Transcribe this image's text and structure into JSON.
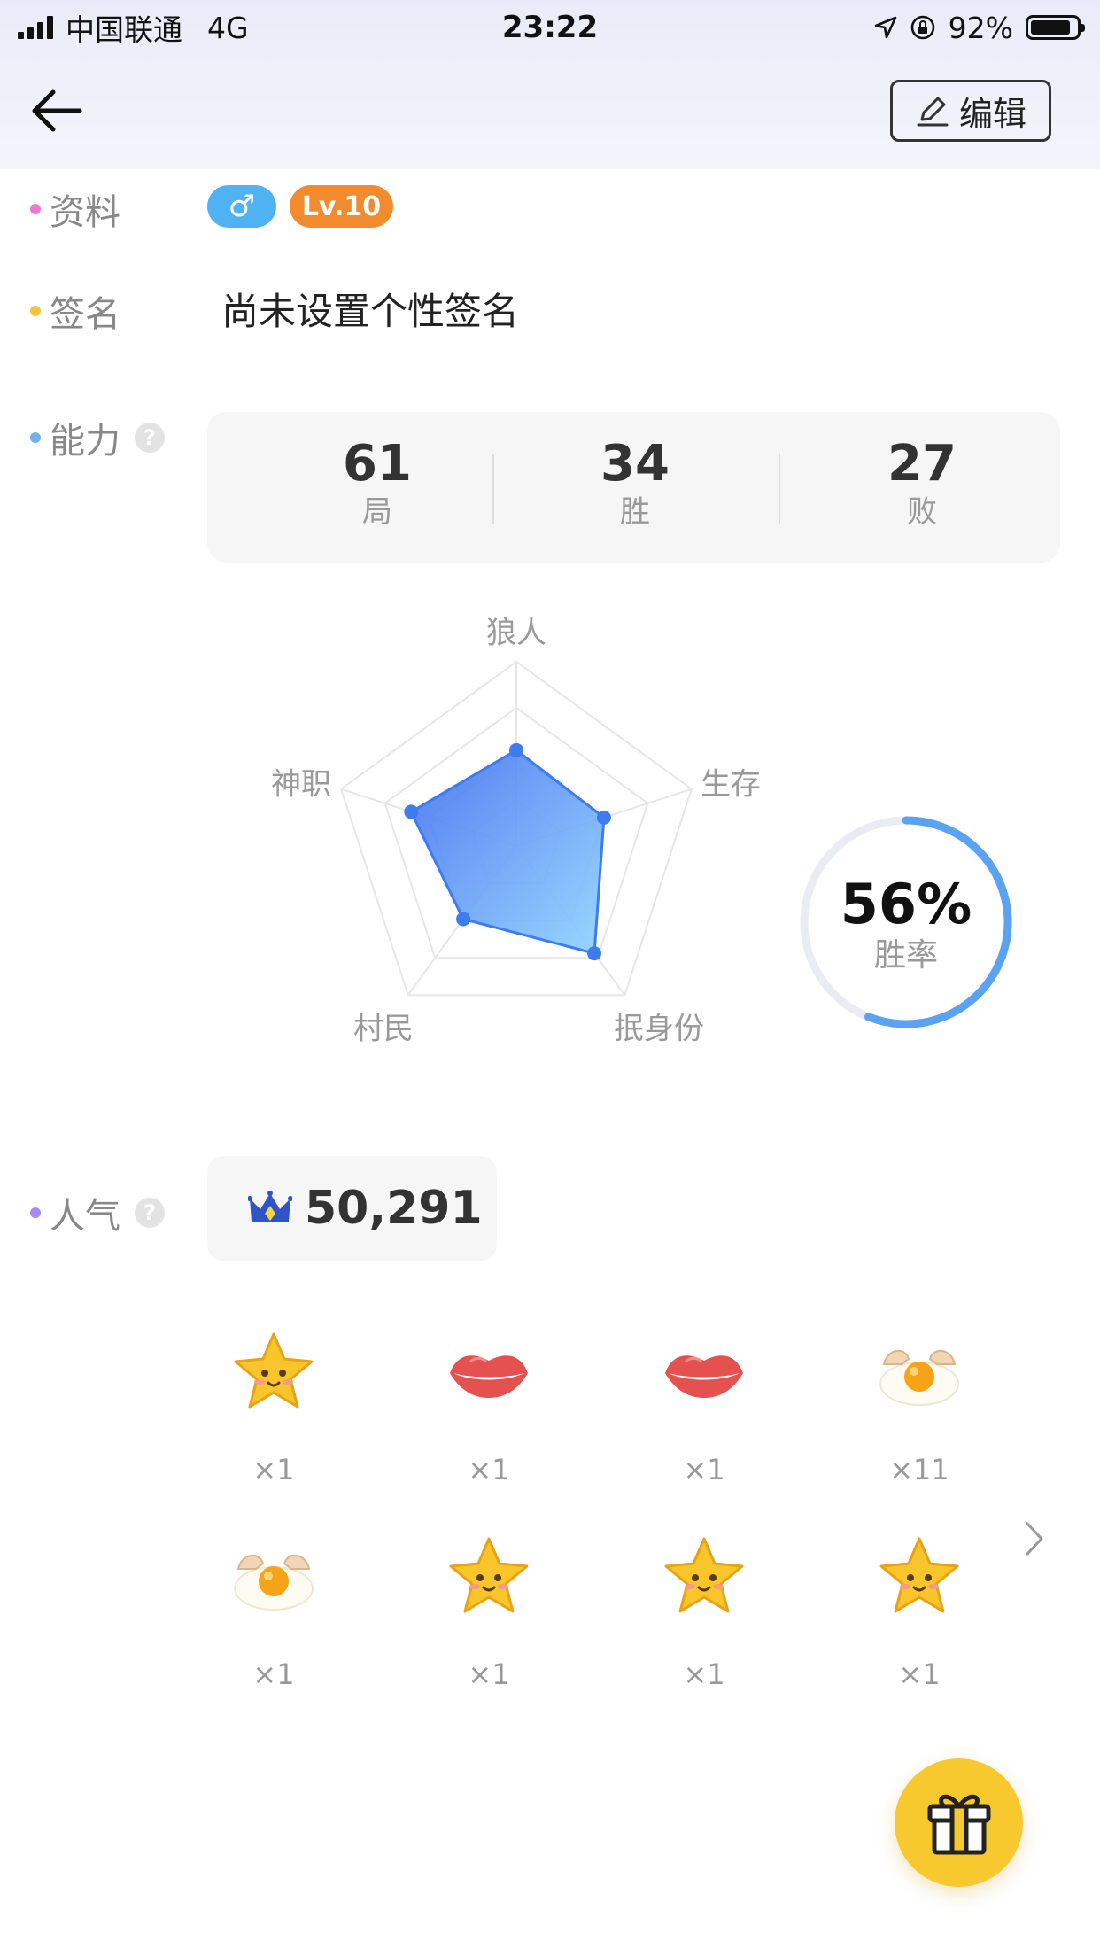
{
  "status_bar": {
    "carrier": "中国联通",
    "network": "4G",
    "time": "23:22",
    "battery_pct": "92%"
  },
  "nav": {
    "edit_label": "编辑"
  },
  "profile": {
    "info_label": "资料",
    "gender_symbol": "♂",
    "level": "Lv.10",
    "signature_label": "签名",
    "signature_text": "尚未设置个性签名"
  },
  "ability": {
    "label": "能力",
    "help": "?",
    "stats": [
      {
        "value": "61",
        "label": "局"
      },
      {
        "value": "34",
        "label": "胜"
      },
      {
        "value": "27",
        "label": "败"
      }
    ],
    "radar": {
      "axes": [
        "狼人",
        "生存",
        "抿身份",
        "村民",
        "神职"
      ],
      "values": [
        0.52,
        0.5,
        0.72,
        0.49,
        0.6
      ]
    },
    "win_rate": {
      "value": "56%",
      "label": "胜率",
      "fraction": 0.56
    }
  },
  "popularity": {
    "label": "人气",
    "help": "?",
    "value": "50,291"
  },
  "gifts": [
    {
      "icon": "star-gift-icon",
      "count": "×1"
    },
    {
      "icon": "lips-gift-icon",
      "count": "×1"
    },
    {
      "icon": "lips-gift-icon",
      "count": "×1"
    },
    {
      "icon": "egg-gift-icon",
      "count": "×11"
    },
    {
      "icon": "egg-gift-icon",
      "count": "×1"
    },
    {
      "icon": "star-gift-icon",
      "count": "×1"
    },
    {
      "icon": "star-gift-icon",
      "count": "×1"
    },
    {
      "icon": "star-gift-icon",
      "count": "×1"
    }
  ],
  "colors": {
    "accent_blue": "#4a90f0",
    "level_orange": "#f28b2e",
    "gender_blue": "#4fb3f3",
    "fab_yellow": "#f7c92e"
  }
}
